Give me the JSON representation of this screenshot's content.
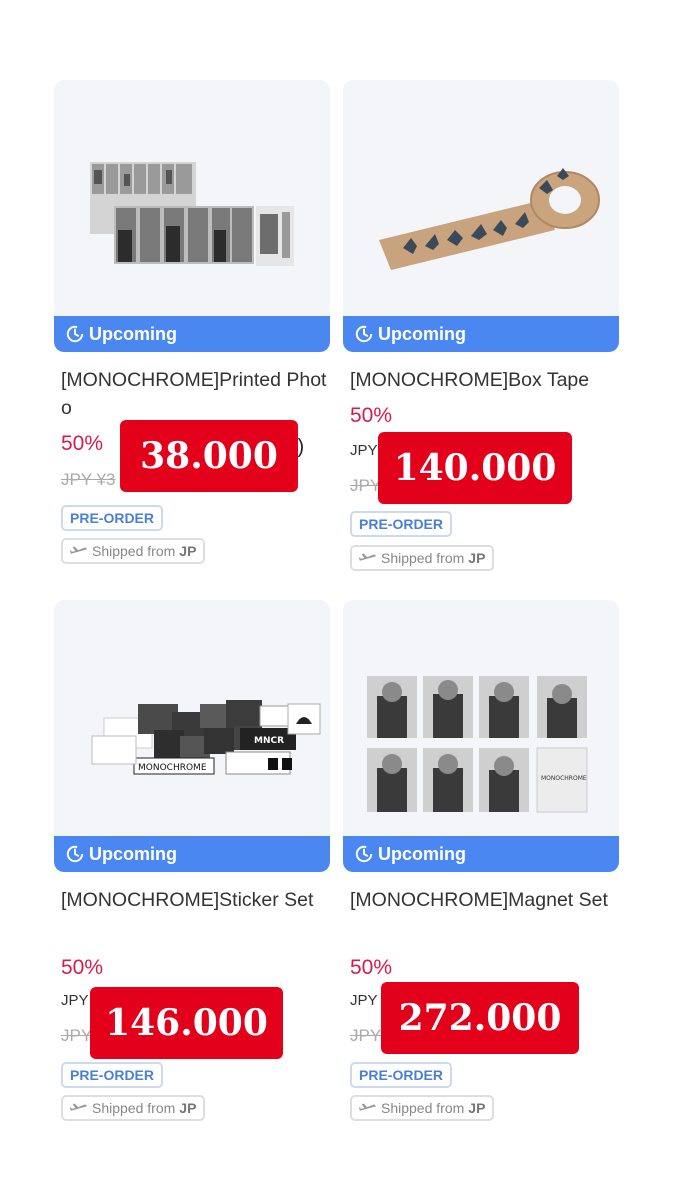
{
  "status_badge": "Upcoming",
  "products": [
    {
      "title": "[MONOCHROME]Printed Photo",
      "discount": "50%",
      "currency": "JPY",
      "original_price": "JPY ¥3",
      "extra_text": ".)",
      "tag": "PRE-ORDER",
      "ship_label": "Shipped from",
      "ship_origin": "JP",
      "overlay_price": "38.000"
    },
    {
      "title": "[MONOCHROME]Box Tape",
      "discount": "50%",
      "currency": "JPY",
      "original_price": "JPY",
      "tag": "PRE-ORDER",
      "ship_label": "Shipped from",
      "ship_origin": "JP",
      "overlay_price": "140.000"
    },
    {
      "title": "[MONOCHROME]Sticker Set",
      "discount": "50%",
      "currency": "JPY",
      "original_price": "JPY",
      "tag": "PRE-ORDER",
      "ship_label": "Shipped from",
      "ship_origin": "JP",
      "overlay_price": "146.000"
    },
    {
      "title": "[MONOCHROME]Magnet Set",
      "discount": "50%",
      "currency": "JPY",
      "original_price": "JPY",
      "tag": "PRE-ORDER",
      "ship_label": "Shipped from",
      "ship_origin": "JP",
      "overlay_price": "272.000"
    }
  ],
  "product_image_text": {
    "sticker_brand": "MONOCHROME",
    "sticker_short": "MNCR",
    "magnet_brand": "MONOCHROME"
  }
}
